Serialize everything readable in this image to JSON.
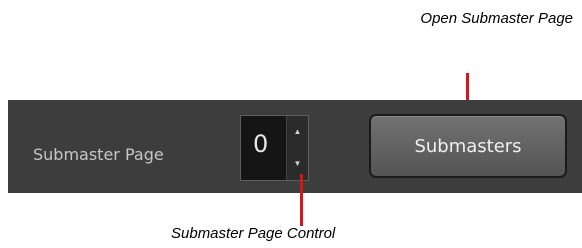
{
  "callouts": {
    "open_submaster_page": "Open Submaster Page",
    "submaster_page_control": "Submaster Page Control"
  },
  "toolbar": {
    "submaster_page_label": "Submaster Page",
    "submaster_page_value": "0",
    "submasters_button_label": "Submasters"
  },
  "icons": {
    "stepper_up": "triangle-up-icon",
    "stepper_down": "triangle-down-icon"
  },
  "colors": {
    "toolbar_background": "#3d3d3d",
    "leader_line": "#d8141c",
    "field_background": "#151515"
  }
}
